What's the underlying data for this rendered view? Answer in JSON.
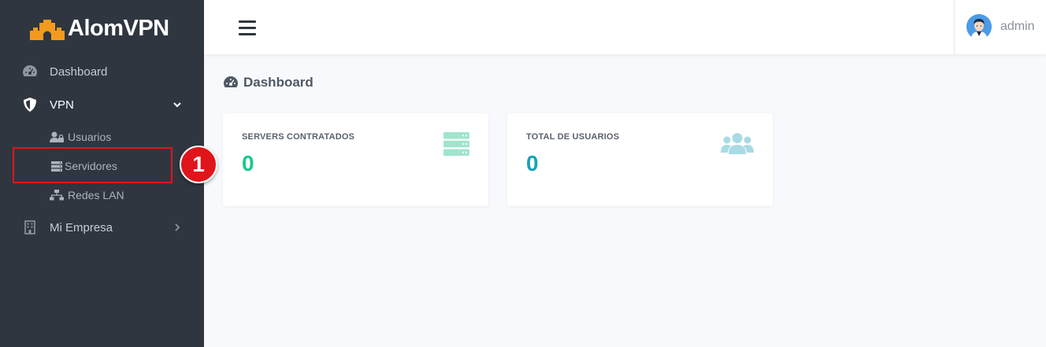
{
  "brand": {
    "name": "AlomVPN",
    "accent": "#f39a1e"
  },
  "sidebar": {
    "items": [
      {
        "label": "Dashboard",
        "icon": "tachometer-icon"
      },
      {
        "label": "VPN",
        "icon": "shield-icon",
        "expanded": true
      },
      {
        "label": "Mi Empresa",
        "icon": "building-icon",
        "expanded": false
      }
    ],
    "vpn_subitems": [
      {
        "label": "Usuarios",
        "icon": "user-lock-icon"
      },
      {
        "label": "Servidores",
        "icon": "server-icon"
      },
      {
        "label": "Redes LAN",
        "icon": "network-icon"
      }
    ]
  },
  "annotation": {
    "step_number": "1",
    "color": "#e0151b"
  },
  "topbar": {
    "username": "admin"
  },
  "main": {
    "page_title": "Dashboard",
    "cards": [
      {
        "label": "SERVERS CONTRATADOS",
        "value": "0",
        "color": "#1cc88a",
        "icon": "server-icon"
      },
      {
        "label": "TOTAL DE USUARIOS",
        "value": "0",
        "color": "#17a2b8",
        "icon": "users-icon"
      }
    ]
  }
}
